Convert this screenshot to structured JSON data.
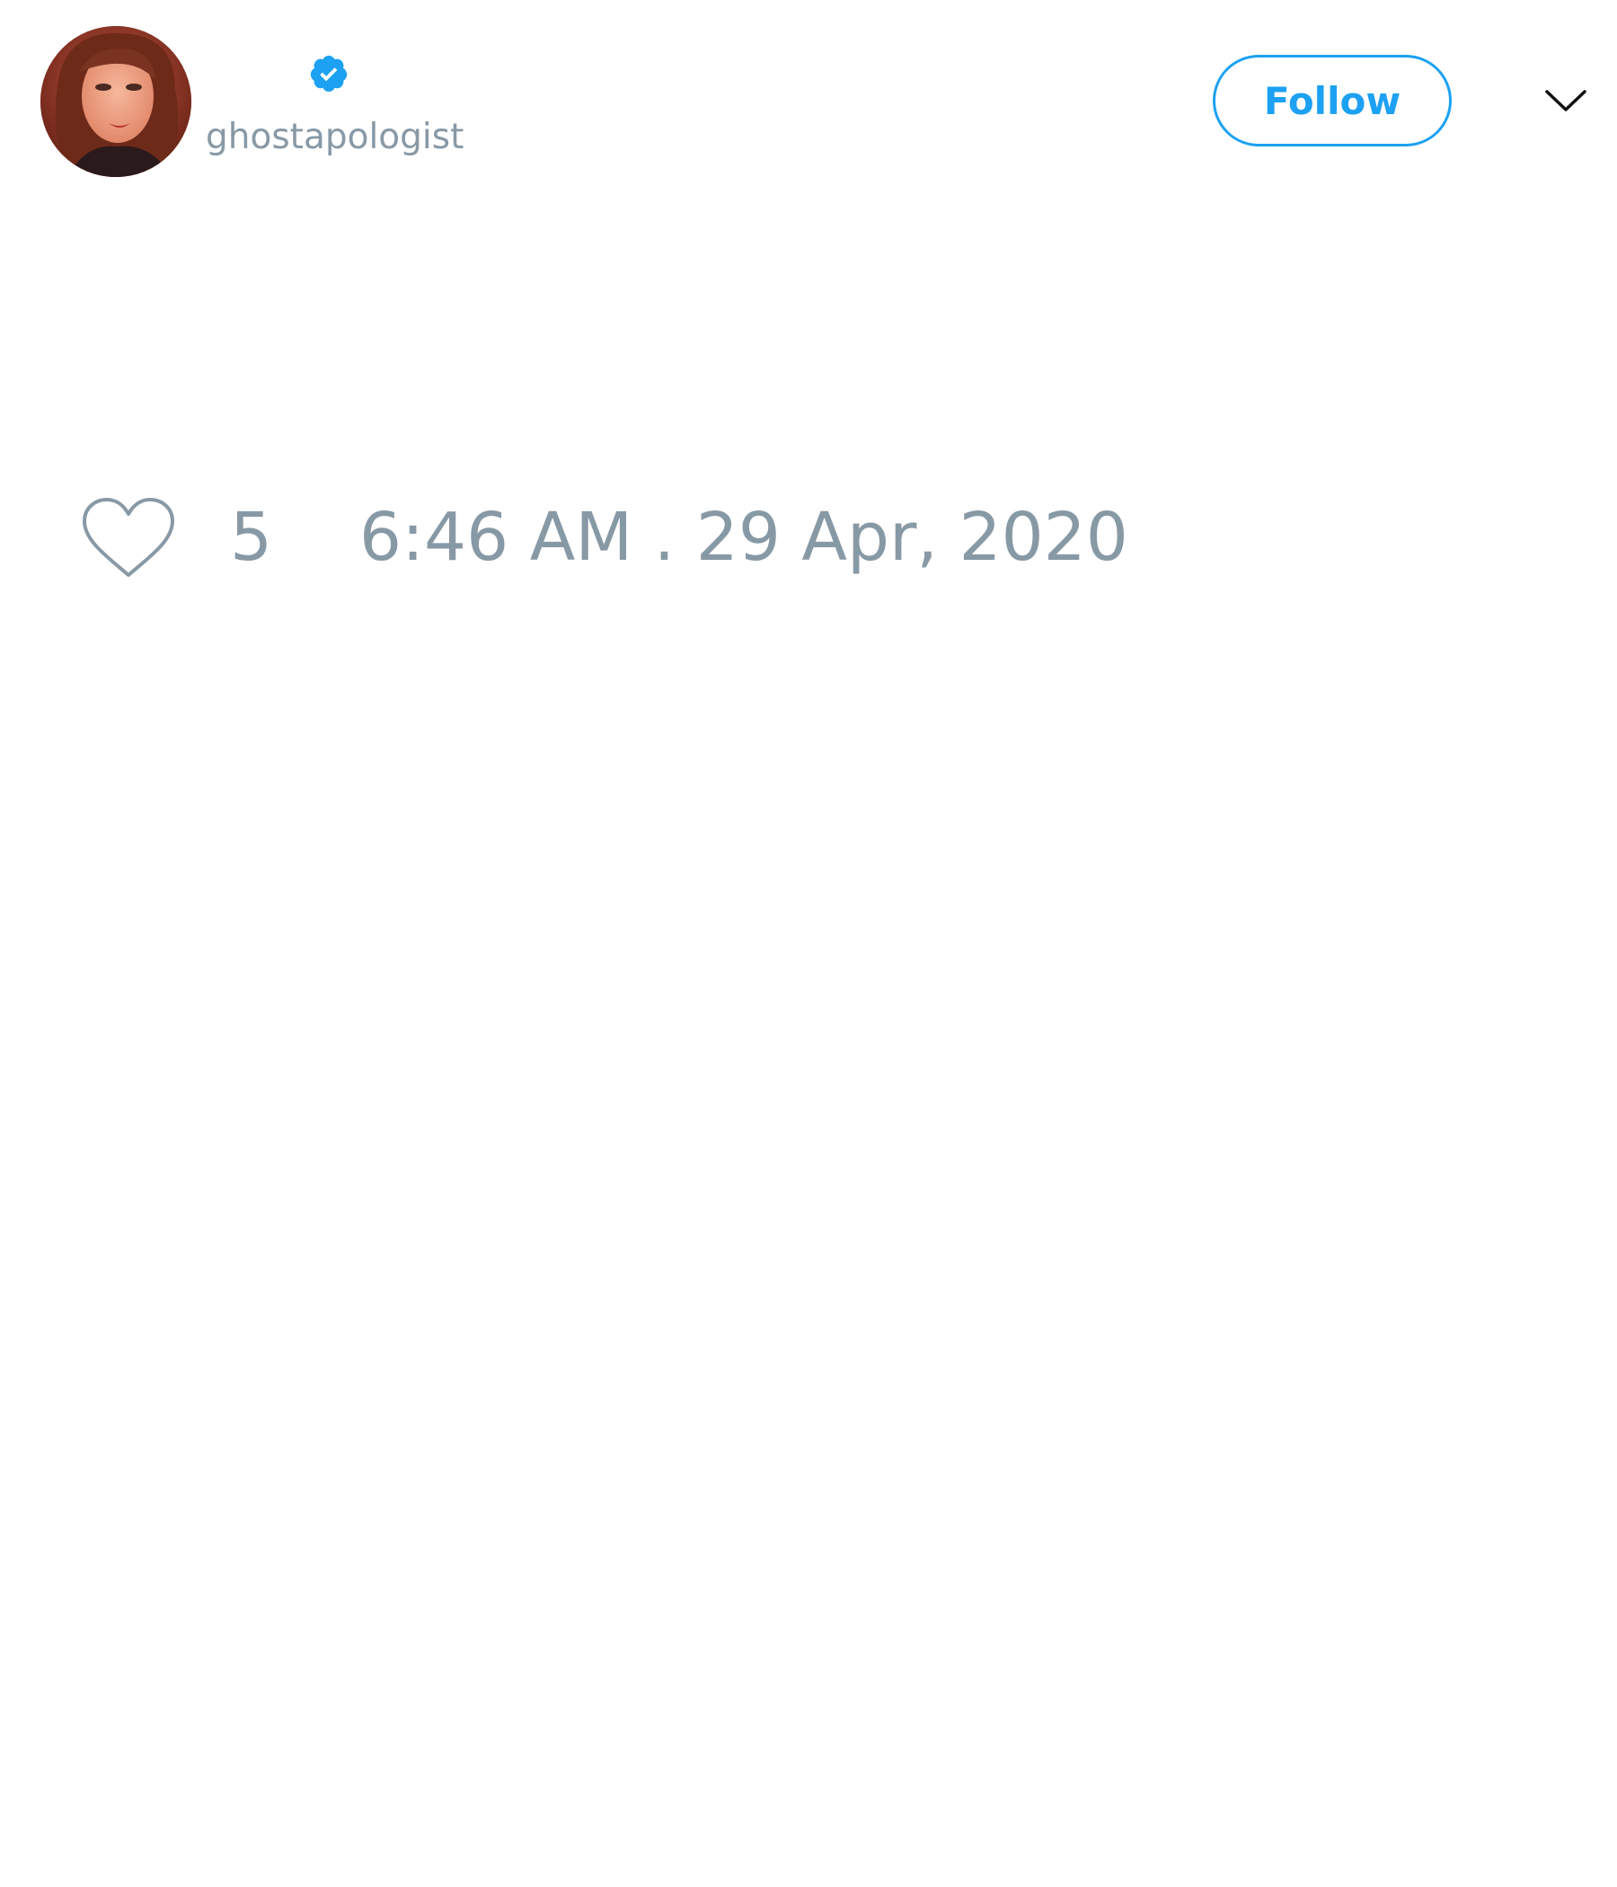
{
  "tweet": {
    "author": {
      "handle": "ghostapologist",
      "verified": true,
      "avatar_icon": "profile-photo"
    },
    "follow_label": "Follow",
    "menu_icon": "chevron-down-icon",
    "likes": {
      "icon": "heart-icon",
      "count": "5"
    },
    "timestamp": "6:46 AM . 29 Apr, 2020"
  },
  "colors": {
    "accent": "#1da1f2",
    "muted_text": "#8899a6",
    "background": "#ffffff"
  }
}
